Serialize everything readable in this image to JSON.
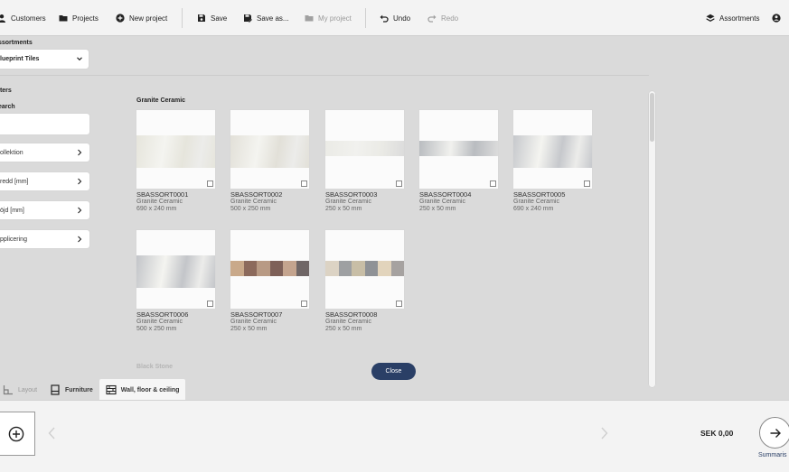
{
  "toolbar": {
    "customers": "Customers",
    "projects": "Projects",
    "new_project": "New project",
    "save": "Save",
    "save_as": "Save as...",
    "my_project": "My project",
    "undo": "Undo",
    "redo": "Redo",
    "assortments": "Assortments"
  },
  "sidebar": {
    "assortments_label": "ssortments",
    "assortment_selected": "lueprint Tiles",
    "filters_label": "lters",
    "search_label": "earch",
    "search_value": "",
    "filters": [
      "ollektion",
      "redd [mm]",
      "öjd [mm]",
      "pplicering"
    ]
  },
  "catalog": {
    "group_title": "Granite Ceramic",
    "next_group_title": "Black Stone",
    "tiles": [
      {
        "code": "SBASSORT0001",
        "series": "Granite Ceramic",
        "size": "690 x 240 mm",
        "pattern": "marble",
        "color": "#e6e5dc"
      },
      {
        "code": "SBASSORT0002",
        "series": "Granite Ceramic",
        "size": "500 x 250 mm",
        "pattern": "marble",
        "color": "#e2e0d8"
      },
      {
        "code": "SBASSORT0003",
        "series": "Granite Ceramic",
        "size": "250 x 50 mm",
        "pattern": "strip",
        "color": "#ebebe6"
      },
      {
        "code": "SBASSORT0004",
        "series": "Granite Ceramic",
        "size": "250 x 50 mm",
        "pattern": "strip",
        "color": "#b9bcc0"
      },
      {
        "code": "SBASSORT0005",
        "series": "Granite Ceramic",
        "size": "690 x 240 mm",
        "pattern": "marble",
        "color": "#c6c8cc"
      },
      {
        "code": "SBASSORT0006",
        "series": "Granite Ceramic",
        "size": "500 x 250 mm",
        "pattern": "marble",
        "color": "#c3c5c9"
      },
      {
        "code": "SBASSORT0007",
        "series": "Granite Ceramic",
        "size": "250 x 50 mm",
        "pattern": "mosaic",
        "colors": [
          "#c9a98a",
          "#8c6a5c",
          "#b89a84",
          "#7e6058",
          "#c4a48e",
          "#6f6666"
        ]
      },
      {
        "code": "SBASSORT0008",
        "series": "Granite Ceramic",
        "size": "250 x 50 mm",
        "pattern": "mosaic",
        "colors": [
          "#dcd3c4",
          "#9ea0a2",
          "#c8bea6",
          "#8f9296",
          "#e2d4bc",
          "#a6a2a0"
        ]
      }
    ]
  },
  "close_label": "Close",
  "tabs": [
    {
      "label": "Layout",
      "icon": "layout-icon"
    },
    {
      "label": "Furniture",
      "icon": "furniture-icon"
    },
    {
      "label": "Wall, floor & ceiling",
      "icon": "wall-icon"
    }
  ],
  "bottom": {
    "price": "SEK  0,00",
    "summary_label": "Summaris"
  },
  "colors": {
    "accent": "#2a3f66",
    "background": "#dadada",
    "bar": "#f3f3f3"
  }
}
